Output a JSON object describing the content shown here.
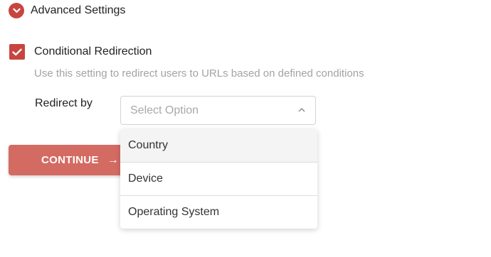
{
  "advanced": {
    "title": "Advanced Settings",
    "toggle_icon": "chevron-down-icon"
  },
  "conditional": {
    "label": "Conditional Redirection",
    "checked": true,
    "help": "Use this setting to redirect users to URLs based on defined conditions"
  },
  "redirect": {
    "label": "Redirect by",
    "placeholder": "Select Option",
    "options": [
      "Country",
      "Device",
      "Operating System"
    ]
  },
  "continue_button": {
    "label": "CONTINUE",
    "arrow": "→"
  },
  "colors": {
    "accent": "#c8453f",
    "button": "#d46b63",
    "muted_text": "#a3a3a3"
  }
}
